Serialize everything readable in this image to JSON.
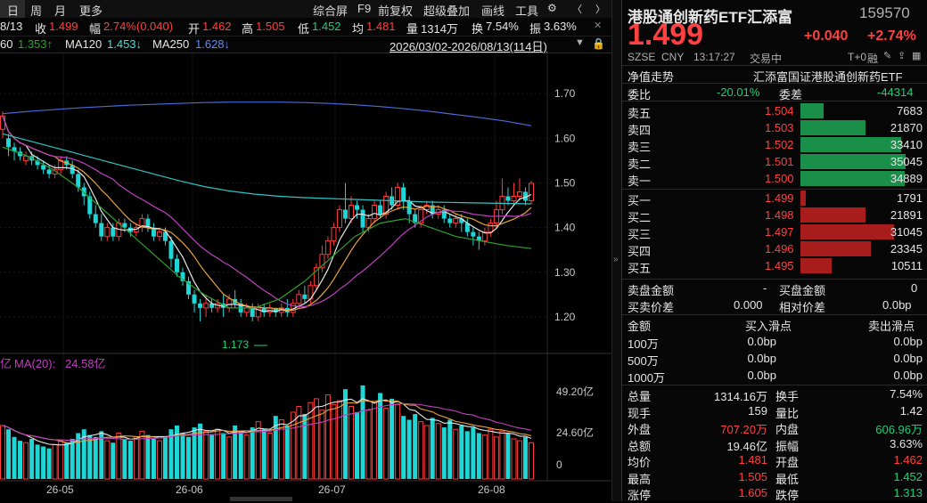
{
  "toolbar": {
    "left": [
      {
        "label": "日"
      },
      {
        "label": "周"
      },
      {
        "label": "月"
      },
      {
        "label": "更多"
      }
    ],
    "right": [
      {
        "label": "综合屏"
      },
      {
        "label": "F9"
      },
      {
        "label": "前复权"
      },
      {
        "label": "超级叠加"
      },
      {
        "label": "画线"
      },
      {
        "label": "工具"
      }
    ]
  },
  "info_row": {
    "date": "8/13",
    "close_label": "收",
    "close": "1.499",
    "change_label": "幅",
    "change": "2.74%(0.040)",
    "open_label": "开",
    "open": "1.462",
    "high_label": "高",
    "high": "1.505",
    "low_label": "低",
    "low": "1.452",
    "avg_label": "均",
    "avg": "1.481",
    "vol_label": "量",
    "vol": "1314万",
    "turn_label": "换",
    "turn": "7.54%",
    "amp_label": "振",
    "amp": "3.63%"
  },
  "ma_row": {
    "ma60_label": "60",
    "ma60": "1.353↑",
    "ma120_label": "MA120",
    "ma120": "1.453↓",
    "ma250_label": "MA250",
    "ma250": "1.628↓",
    "range": "2026/03/02-2026/08/13(114日)"
  },
  "chart_data": {
    "type": "candlestick",
    "price_axis": {
      "ticks": [
        "1.70",
        "1.60",
        "1.50",
        "1.40",
        "1.30",
        "1.20"
      ],
      "ylim": [
        1.14,
        1.79
      ]
    },
    "low_marker": "1.173",
    "volume_axis": {
      "ticks": [
        "49.20亿",
        "24.60亿",
        "0"
      ]
    },
    "volume_legend": {
      "left": "亿",
      "ma_label": "MA(20):",
      "ma_value": "24.58亿"
    },
    "x_ticks": [
      "26-05",
      "26-06",
      "26-07",
      "26-08"
    ],
    "ma250": [
      1.655,
      1.66,
      1.664,
      1.668,
      1.671,
      1.674,
      1.676,
      1.678,
      1.68,
      1.681,
      1.681,
      1.681,
      1.68,
      1.678,
      1.675,
      1.671,
      1.666,
      1.66,
      1.653,
      1.646,
      1.638,
      1.628
    ],
    "ma120": [
      1.61,
      1.595,
      1.58,
      1.565,
      1.55,
      1.535,
      1.52,
      1.505,
      1.492,
      1.482,
      1.475,
      1.47,
      1.467,
      1.465,
      1.463,
      1.461,
      1.459,
      1.457,
      1.456,
      1.455,
      1.454,
      1.453
    ],
    "ma60": [
      1.58,
      1.56,
      1.53,
      1.49,
      1.44,
      1.39,
      1.34,
      1.29,
      1.25,
      1.22,
      1.22,
      1.24,
      1.28,
      1.33,
      1.38,
      1.41,
      1.42,
      1.4,
      1.38,
      1.37,
      1.36,
      1.353
    ],
    "candles": [
      [
        1.62,
        1.65,
        1.6,
        1.66
      ],
      [
        1.6,
        1.58,
        1.56,
        1.61
      ],
      [
        1.58,
        1.57,
        1.55,
        1.59
      ],
      [
        1.57,
        1.56,
        1.55,
        1.58
      ],
      [
        1.55,
        1.56,
        1.54,
        1.57
      ],
      [
        1.56,
        1.55,
        1.54,
        1.57
      ],
      [
        1.55,
        1.54,
        1.53,
        1.56
      ],
      [
        1.54,
        1.53,
        1.52,
        1.55
      ],
      [
        1.53,
        1.52,
        1.51,
        1.54
      ],
      [
        1.52,
        1.53,
        1.51,
        1.54
      ],
      [
        1.53,
        1.55,
        1.52,
        1.56
      ],
      [
        1.55,
        1.54,
        1.53,
        1.56
      ],
      [
        1.54,
        1.52,
        1.51,
        1.55
      ],
      [
        1.52,
        1.49,
        1.48,
        1.53
      ],
      [
        1.49,
        1.47,
        1.45,
        1.5
      ],
      [
        1.47,
        1.43,
        1.42,
        1.48
      ],
      [
        1.43,
        1.41,
        1.4,
        1.45
      ],
      [
        1.41,
        1.38,
        1.37,
        1.43
      ],
      [
        1.38,
        1.4,
        1.37,
        1.41
      ],
      [
        1.4,
        1.38,
        1.37,
        1.41
      ],
      [
        1.38,
        1.41,
        1.37,
        1.42
      ],
      [
        1.41,
        1.4,
        1.39,
        1.42
      ],
      [
        1.4,
        1.39,
        1.38,
        1.41
      ],
      [
        1.39,
        1.4,
        1.38,
        1.41
      ],
      [
        1.4,
        1.42,
        1.39,
        1.43
      ],
      [
        1.42,
        1.4,
        1.39,
        1.43
      ],
      [
        1.4,
        1.38,
        1.37,
        1.41
      ],
      [
        1.38,
        1.39,
        1.37,
        1.4
      ],
      [
        1.39,
        1.37,
        1.36,
        1.4
      ],
      [
        1.37,
        1.33,
        1.31,
        1.38
      ],
      [
        1.33,
        1.3,
        1.29,
        1.34
      ],
      [
        1.3,
        1.28,
        1.27,
        1.31
      ],
      [
        1.28,
        1.25,
        1.24,
        1.29
      ],
      [
        1.25,
        1.23,
        1.21,
        1.26
      ],
      [
        1.23,
        1.22,
        1.19,
        1.24
      ],
      [
        1.22,
        1.23,
        1.2,
        1.25
      ],
      [
        1.23,
        1.22,
        1.21,
        1.24
      ],
      [
        1.22,
        1.23,
        1.21,
        1.24
      ],
      [
        1.23,
        1.22,
        1.2,
        1.25
      ],
      [
        1.22,
        1.24,
        1.21,
        1.25
      ],
      [
        1.24,
        1.23,
        1.22,
        1.26
      ],
      [
        1.23,
        1.21,
        1.2,
        1.24
      ],
      [
        1.21,
        1.22,
        1.2,
        1.23
      ],
      [
        1.22,
        1.2,
        1.19,
        1.23
      ],
      [
        1.2,
        1.22,
        1.19,
        1.23
      ],
      [
        1.22,
        1.21,
        1.2,
        1.23
      ],
      [
        1.21,
        1.22,
        1.2,
        1.23
      ],
      [
        1.22,
        1.21,
        1.2,
        1.22
      ],
      [
        1.21,
        1.22,
        1.2,
        1.23
      ],
      [
        1.22,
        1.21,
        1.2,
        1.24
      ],
      [
        1.21,
        1.23,
        1.2,
        1.24
      ],
      [
        1.23,
        1.25,
        1.22,
        1.26
      ],
      [
        1.25,
        1.24,
        1.23,
        1.27
      ],
      [
        1.24,
        1.27,
        1.23,
        1.28
      ],
      [
        1.27,
        1.31,
        1.26,
        1.32
      ],
      [
        1.31,
        1.34,
        1.3,
        1.36
      ],
      [
        1.34,
        1.37,
        1.33,
        1.38
      ],
      [
        1.37,
        1.4,
        1.36,
        1.41
      ],
      [
        1.4,
        1.44,
        1.39,
        1.45
      ],
      [
        1.44,
        1.42,
        1.41,
        1.5
      ],
      [
        1.42,
        1.45,
        1.41,
        1.47
      ],
      [
        1.45,
        1.44,
        1.42,
        1.46
      ],
      [
        1.44,
        1.4,
        1.39,
        1.45
      ],
      [
        1.4,
        1.42,
        1.39,
        1.43
      ],
      [
        1.42,
        1.45,
        1.41,
        1.46
      ],
      [
        1.45,
        1.43,
        1.42,
        1.46
      ],
      [
        1.43,
        1.47,
        1.42,
        1.48
      ],
      [
        1.47,
        1.45,
        1.44,
        1.49
      ],
      [
        1.45,
        1.49,
        1.44,
        1.5
      ],
      [
        1.49,
        1.46,
        1.44,
        1.5
      ],
      [
        1.46,
        1.43,
        1.41,
        1.47
      ],
      [
        1.43,
        1.41,
        1.4,
        1.44
      ],
      [
        1.41,
        1.44,
        1.4,
        1.45
      ],
      [
        1.44,
        1.45,
        1.43,
        1.46
      ],
      [
        1.45,
        1.43,
        1.42,
        1.46
      ],
      [
        1.43,
        1.44,
        1.42,
        1.45
      ],
      [
        1.44,
        1.42,
        1.41,
        1.45
      ],
      [
        1.42,
        1.41,
        1.4,
        1.43
      ],
      [
        1.41,
        1.42,
        1.4,
        1.43
      ],
      [
        1.42,
        1.41,
        1.39,
        1.43
      ],
      [
        1.41,
        1.39,
        1.38,
        1.42
      ],
      [
        1.39,
        1.38,
        1.36,
        1.4
      ],
      [
        1.38,
        1.37,
        1.35,
        1.39
      ],
      [
        1.37,
        1.39,
        1.36,
        1.4
      ],
      [
        1.39,
        1.41,
        1.38,
        1.42
      ],
      [
        1.41,
        1.44,
        1.4,
        1.46
      ],
      [
        1.44,
        1.47,
        1.43,
        1.51
      ],
      [
        1.47,
        1.46,
        1.45,
        1.49
      ],
      [
        1.46,
        1.47,
        1.45,
        1.5
      ],
      [
        1.47,
        1.48,
        1.46,
        1.51
      ],
      [
        1.48,
        1.46,
        1.45,
        1.49
      ],
      [
        1.46,
        1.499,
        1.452,
        1.505
      ]
    ],
    "volumes": [
      28,
      26,
      22,
      20,
      19,
      21,
      18,
      17,
      16,
      18,
      20,
      19,
      21,
      24,
      26,
      23,
      22,
      25,
      20,
      19,
      24,
      21,
      20,
      22,
      25,
      23,
      21,
      20,
      22,
      26,
      28,
      24,
      22,
      27,
      29,
      25,
      23,
      26,
      24,
      22,
      28,
      25,
      23,
      27,
      30,
      26,
      24,
      33,
      31,
      28,
      35,
      38,
      34,
      40,
      42,
      36,
      44,
      39,
      41,
      47,
      38,
      35,
      49,
      36,
      40,
      45,
      37,
      42,
      39,
      33,
      31,
      34,
      30,
      28,
      32,
      29,
      27,
      31,
      26,
      28,
      25,
      27,
      24,
      23,
      26,
      22,
      25,
      24,
      21,
      20,
      22,
      19
    ]
  },
  "quote": {
    "name": "港股通创新药ETF汇添富",
    "code": "159570",
    "price": "1.499",
    "change": "+0.040",
    "change_pct": "+2.74%",
    "market": "SZSE",
    "currency": "CNY",
    "time": "13:17:27",
    "status": "交易中",
    "tplus": "T+0",
    "margin": "融",
    "net_label": "净值走势",
    "fund_full": "汇添富国证港股通创新药ETF"
  },
  "ratio": {
    "label_wb": "委比",
    "wb": "-20.01%",
    "label_wc": "委差",
    "wc": "-44314"
  },
  "asks": [
    {
      "label": "卖五",
      "price": "1.504",
      "vol": "7683",
      "frac": 0.22
    },
    {
      "label": "卖四",
      "price": "1.503",
      "vol": "21870",
      "frac": 0.62
    },
    {
      "label": "卖三",
      "price": "1.502",
      "vol": "33410",
      "frac": 0.96
    },
    {
      "label": "卖二",
      "price": "1.501",
      "vol": "35045",
      "frac": 1.0
    },
    {
      "label": "卖一",
      "price": "1.500",
      "vol": "34889",
      "frac": 0.99
    }
  ],
  "bids": [
    {
      "label": "买一",
      "price": "1.499",
      "vol": "1791",
      "frac": 0.05
    },
    {
      "label": "买二",
      "price": "1.498",
      "vol": "21891",
      "frac": 0.62
    },
    {
      "label": "买三",
      "price": "1.497",
      "vol": "31045",
      "frac": 0.89
    },
    {
      "label": "买四",
      "price": "1.496",
      "vol": "23345",
      "frac": 0.67
    },
    {
      "label": "买五",
      "price": "1.495",
      "vol": "10511",
      "frac": 0.3
    }
  ],
  "order_amt": {
    "sell_amt_label": "卖盘金额",
    "sell_amt": "-",
    "buy_amt_label": "买盘金额",
    "buy_amt": "0",
    "spread_label": "买卖价差",
    "spread": "0.000",
    "rel_label": "相对价差",
    "rel": "0.0bp"
  },
  "slippage": {
    "headers": [
      "金额",
      "买入滑点",
      "卖出滑点"
    ],
    "rows": [
      [
        "100万",
        "0.0bp",
        "0.0bp"
      ],
      [
        "500万",
        "0.0bp",
        "0.0bp"
      ],
      [
        "1000万",
        "0.0bp",
        "0.0bp"
      ]
    ]
  },
  "stats": [
    [
      {
        "l": "总量",
        "v": "1314.16万",
        "c": "white"
      },
      {
        "l": "换手",
        "v": "7.54%",
        "c": "white"
      }
    ],
    [
      {
        "l": "现手",
        "v": "159",
        "c": "white"
      },
      {
        "l": "量比",
        "v": "1.42",
        "c": "white"
      }
    ],
    [
      {
        "l": "外盘",
        "v": "707.20万",
        "c": "red"
      },
      {
        "l": "内盘",
        "v": "606.96万",
        "c": "green"
      }
    ],
    [
      {
        "l": "总额",
        "v": "19.46亿",
        "c": "white"
      },
      {
        "l": "振幅",
        "v": "3.63%",
        "c": "white"
      }
    ],
    [
      {
        "l": "均价",
        "v": "1.481",
        "c": "red"
      },
      {
        "l": "开盘",
        "v": "1.462",
        "c": "red"
      }
    ],
    [
      {
        "l": "最高",
        "v": "1.505",
        "c": "red"
      },
      {
        "l": "最低",
        "v": "1.452",
        "c": "green"
      }
    ],
    [
      {
        "l": "涨停",
        "v": "1.605",
        "c": "red"
      },
      {
        "l": "跌停",
        "v": "1.313",
        "c": "green"
      }
    ]
  ],
  "colors": {
    "up": "#ff3b3b",
    "down": "#1fd6d6",
    "ma250": "#4f6bd8",
    "ma120": "#2ec4c4",
    "ma60": "#2fa02f",
    "ma_orange": "#e8a33c",
    "ma_magenta": "#c040c0",
    "ask_bar": "#1a8f4a",
    "bid_bar": "#a81c1c"
  }
}
